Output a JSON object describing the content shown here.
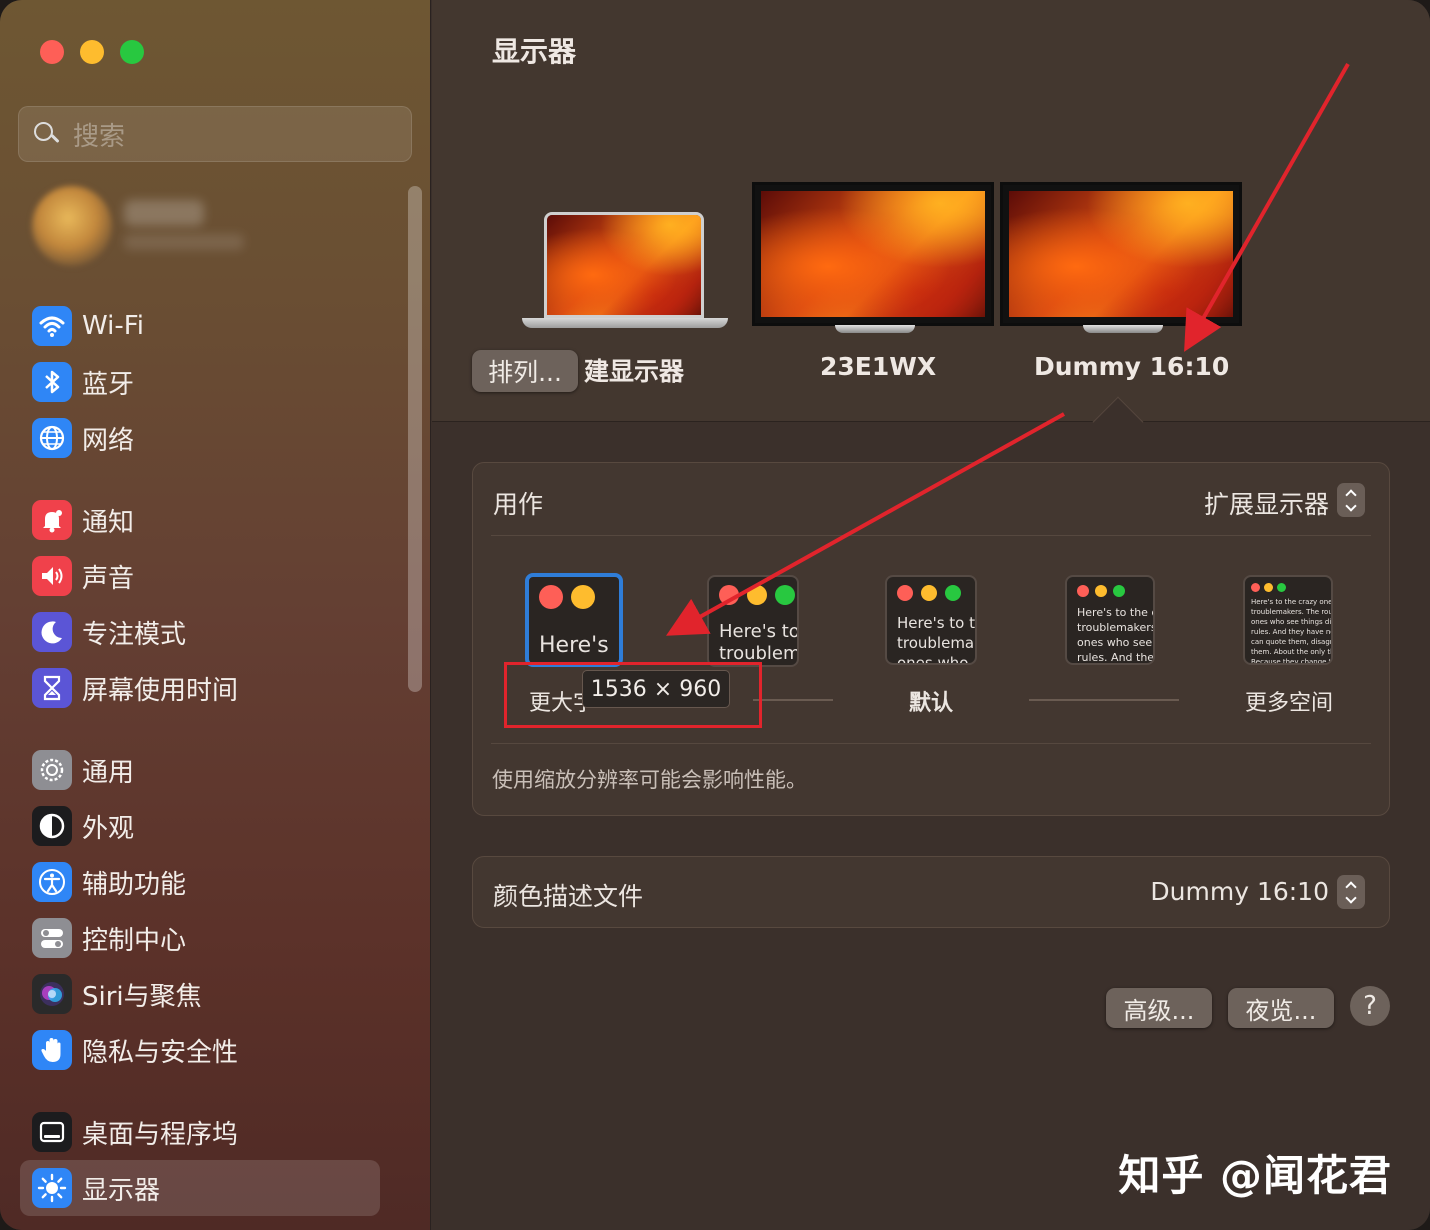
{
  "window": {
    "title": "显示器"
  },
  "search": {
    "placeholder": "搜索"
  },
  "sidebar": {
    "items": [
      {
        "label": "Wi-Fi",
        "icon": "wifi-icon",
        "color": "#2f86f6"
      },
      {
        "label": "蓝牙",
        "icon": "bluetooth-icon",
        "color": "#2f86f6"
      },
      {
        "label": "网络",
        "icon": "globe-icon",
        "color": "#2f86f6"
      },
      {
        "label": "通知",
        "icon": "bell-icon",
        "color": "#f0414b"
      },
      {
        "label": "声音",
        "icon": "speaker-icon",
        "color": "#f0414b"
      },
      {
        "label": "专注模式",
        "icon": "moon-icon",
        "color": "#5b55d6"
      },
      {
        "label": "屏幕使用时间",
        "icon": "hourglass-icon",
        "color": "#5b55d6"
      },
      {
        "label": "通用",
        "icon": "gear-icon",
        "color": "#8e8e93"
      },
      {
        "label": "外观",
        "icon": "appearance-icon",
        "color": "#1c1c1e"
      },
      {
        "label": "辅助功能",
        "icon": "accessibility-icon",
        "color": "#2f86f6"
      },
      {
        "label": "控制中心",
        "icon": "toggles-icon",
        "color": "#8e8e93"
      },
      {
        "label": "Siri与聚焦",
        "icon": "siri-icon",
        "color": "#2a2a2a"
      },
      {
        "label": "隐私与安全性",
        "icon": "hand-icon",
        "color": "#2f86f6"
      },
      {
        "label": "桌面与程序坞",
        "icon": "dock-icon",
        "color": "#1c1c1e"
      },
      {
        "label": "显示器",
        "icon": "sun-icon",
        "color": "#2f86f6",
        "active": true
      }
    ]
  },
  "displays": {
    "arrange_button": "排列...",
    "builtin_label": "建显示器",
    "monitor1_label": "23E1WX",
    "monitor2_label": "Dummy 16:10"
  },
  "use_as": {
    "label": "用作",
    "value": "扩展显示器"
  },
  "resolution": {
    "options": [
      {
        "label": "更大字",
        "preview": "Here's"
      },
      {
        "label": "",
        "preview": "Here's to\ntroublem"
      },
      {
        "label": "默认",
        "preview": "Here's to t\ntroublema\nones who"
      },
      {
        "label": "",
        "preview": "Here's to the cr\ntroublemakers.\nones who see t\nrules. And they"
      },
      {
        "label": "更多空间",
        "preview": "Here's to the crazy one\ntroublemakers. The rou\nones who see things dif\nrules. And they have no\ncan quote them, disagre\nthem. About the only th\nBecause they change th"
      }
    ],
    "tooltip": "1536 × 960",
    "note": "使用缩放分辨率可能会影响性能。"
  },
  "color_profile": {
    "label": "颜色描述文件",
    "value": "Dummy 16:10"
  },
  "buttons": {
    "advanced": "高级...",
    "night_shift": "夜览...",
    "help": "?"
  },
  "watermark": "知乎 @闻花君",
  "colors": {
    "accent": "#2f7dd8",
    "annotation_red": "#e1242c"
  }
}
